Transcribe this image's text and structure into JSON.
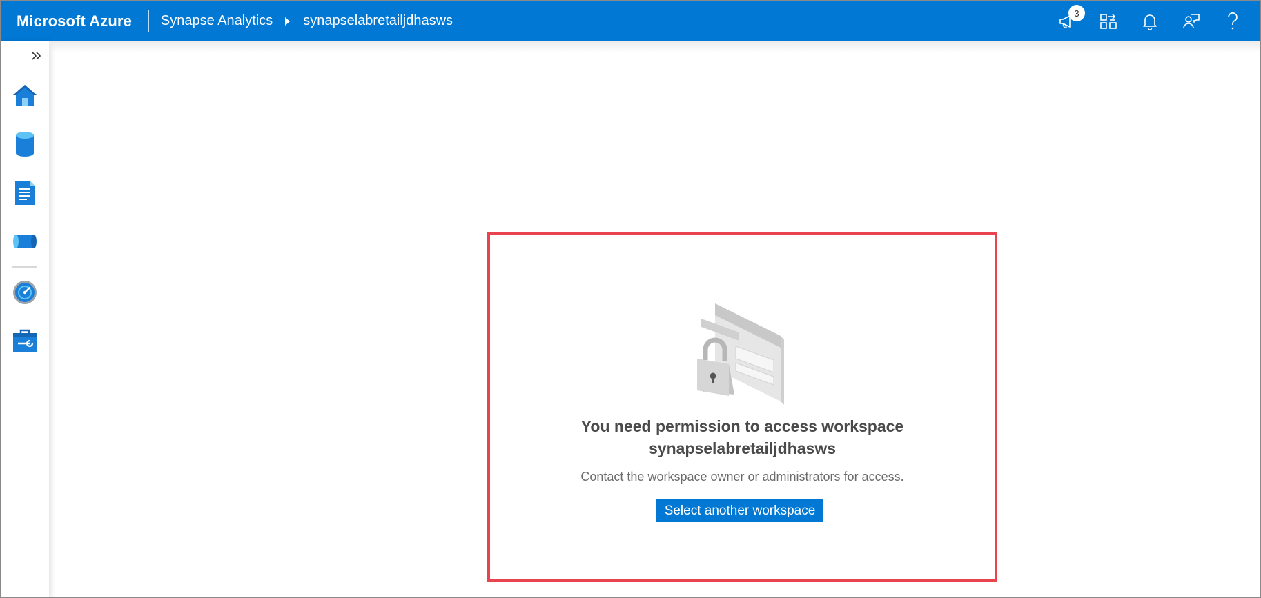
{
  "header": {
    "brand": "Microsoft Azure",
    "breadcrumb": [
      "Synapse Analytics",
      "synapselabretailjdhasws"
    ],
    "notification_count": "3",
    "icons": [
      "announcement-icon",
      "switch-directory-icon",
      "notifications-bell-icon",
      "feedback-icon",
      "help-icon"
    ],
    "color": "#0078d4"
  },
  "sidebar": {
    "items": [
      {
        "icon": "home-icon"
      },
      {
        "icon": "data-icon"
      },
      {
        "icon": "develop-icon"
      },
      {
        "icon": "integrate-icon"
      },
      {
        "icon": "monitor-icon"
      },
      {
        "icon": "manage-icon"
      }
    ]
  },
  "main": {
    "title_line1": "You need permission to access workspace",
    "title_line2": "synapselabretailjdhasws",
    "subtitle": "Contact the workspace owner or administrators for access.",
    "button_label": "Select another workspace",
    "highlight_color": "#e8434f"
  }
}
